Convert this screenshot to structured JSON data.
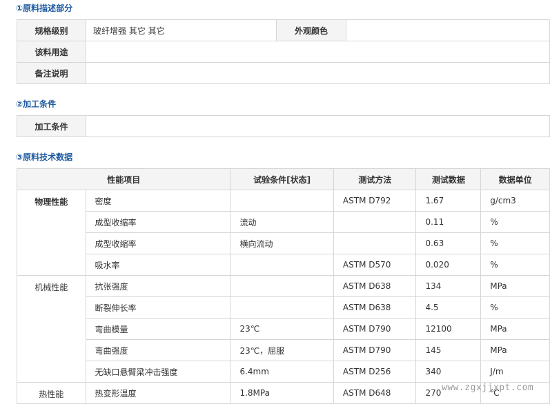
{
  "sections": {
    "desc_title": "①原料描述部分",
    "proc_title": "②加工条件",
    "tech_title": "③原料技术数据"
  },
  "desc": {
    "spec_label": "规格级别",
    "spec_value": "玻纤增强 其它 其它",
    "color_label": "外观颜色",
    "color_value": "",
    "usage_label": "该料用途",
    "usage_value": "",
    "note_label": "备注说明",
    "note_value": ""
  },
  "proc": {
    "label": "加工条件",
    "value": ""
  },
  "tech": {
    "headers": [
      "性能项目",
      "试验条件[状态]",
      "测试方法",
      "测试数据",
      "数据单位"
    ],
    "groups": {
      "physical": "物理性能",
      "mechanical": "机械性能",
      "thermal": "热性能"
    },
    "rows": [
      {
        "item": "密度",
        "cond": "",
        "method": "ASTM D792",
        "value": "1.67",
        "unit": "g/cm3"
      },
      {
        "item": "成型收缩率",
        "cond": "流动",
        "method": "",
        "value": "0.11",
        "unit": "%"
      },
      {
        "item": "成型收缩率",
        "cond": "横向流动",
        "method": "",
        "value": "0.63",
        "unit": "%"
      },
      {
        "item": "吸水率",
        "cond": "",
        "method": "ASTM D570",
        "value": "0.020",
        "unit": "%"
      },
      {
        "item": "抗张强度",
        "cond": "",
        "method": "ASTM D638",
        "value": "134",
        "unit": "MPa"
      },
      {
        "item": "断裂伸长率",
        "cond": "",
        "method": "ASTM D638",
        "value": "4.5",
        "unit": "%"
      },
      {
        "item": "弯曲模量",
        "cond": "23℃",
        "method": "ASTM D790",
        "value": "12100",
        "unit": "MPa"
      },
      {
        "item": "弯曲强度",
        "cond": "23℃，屈服",
        "method": "ASTM D790",
        "value": "145",
        "unit": "MPa"
      },
      {
        "item": "无缺口悬臂梁冲击强度",
        "cond": "6.4mm",
        "method": "ASTM D256",
        "value": "340",
        "unit": "J/m"
      },
      {
        "item": "热变形温度",
        "cond": "1.8MPa",
        "method": "ASTM D648",
        "value": "270",
        "unit": "℃"
      }
    ]
  },
  "watermark": "www.zgxjjxpt.com"
}
